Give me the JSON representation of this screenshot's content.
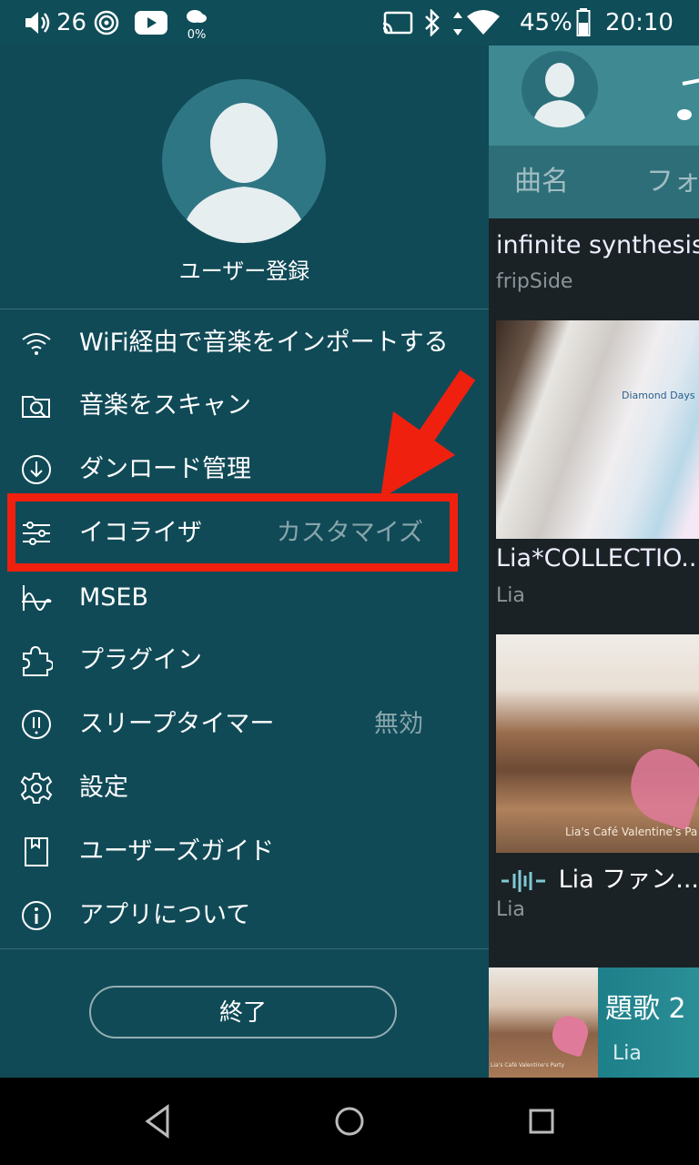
{
  "status_bar": {
    "volume_level": "26",
    "battery": "45%",
    "time": "20:10",
    "weather_badge": "0%",
    "icons": [
      "volume-icon",
      "sync-icon",
      "youtube-icon",
      "weather-icon",
      "cast-icon",
      "bluetooth-icon",
      "data-arrows-icon",
      "wifi-icon",
      "battery-icon"
    ]
  },
  "drawer": {
    "register_label": "ユーザー登録",
    "items": [
      {
        "label": "WiFi経由で音楽をインポートする",
        "value": "",
        "icon": "wifi-icon"
      },
      {
        "label": "音楽をスキャン",
        "value": "",
        "icon": "scan-icon"
      },
      {
        "label": "ダンロード管理",
        "value": "",
        "icon": "download-icon"
      },
      {
        "label": "イコライザ",
        "value": "カスタマイズ",
        "icon": "equalizer-icon"
      },
      {
        "label": "MSEB",
        "value": "",
        "icon": "waveform-icon"
      },
      {
        "label": "プラグイン",
        "value": "",
        "icon": "puzzle-icon"
      },
      {
        "label": "スリープタイマー",
        "value": "無効",
        "icon": "sleep-timer-icon"
      },
      {
        "label": "設定",
        "value": "",
        "icon": "gear-icon"
      },
      {
        "label": "ユーザーズガイド",
        "value": "",
        "icon": "guide-icon"
      },
      {
        "label": "アプリについて",
        "value": "",
        "icon": "info-icon"
      }
    ],
    "exit_label": "終了"
  },
  "main": {
    "tabs": [
      "曲名",
      "フォ"
    ],
    "tracks": [
      {
        "title": "infinite synthesis",
        "artist": "fripSide"
      },
      {
        "title": "Lia*COLLECTIO...",
        "artist": "Lia",
        "art_text": "Diamond Days"
      },
      {
        "title": "Lia ファン...",
        "artist": "Lia",
        "art_text": "Lia's Café Valentine's Pa"
      }
    ],
    "mini_player": {
      "title": "題歌 2",
      "artist": "Lia",
      "art_text": "Lia's Café Valentine's Party"
    }
  },
  "colors": {
    "drawer_bg": "#104a57",
    "header_bg": "#3f8993",
    "highlight": "#f0200f"
  }
}
